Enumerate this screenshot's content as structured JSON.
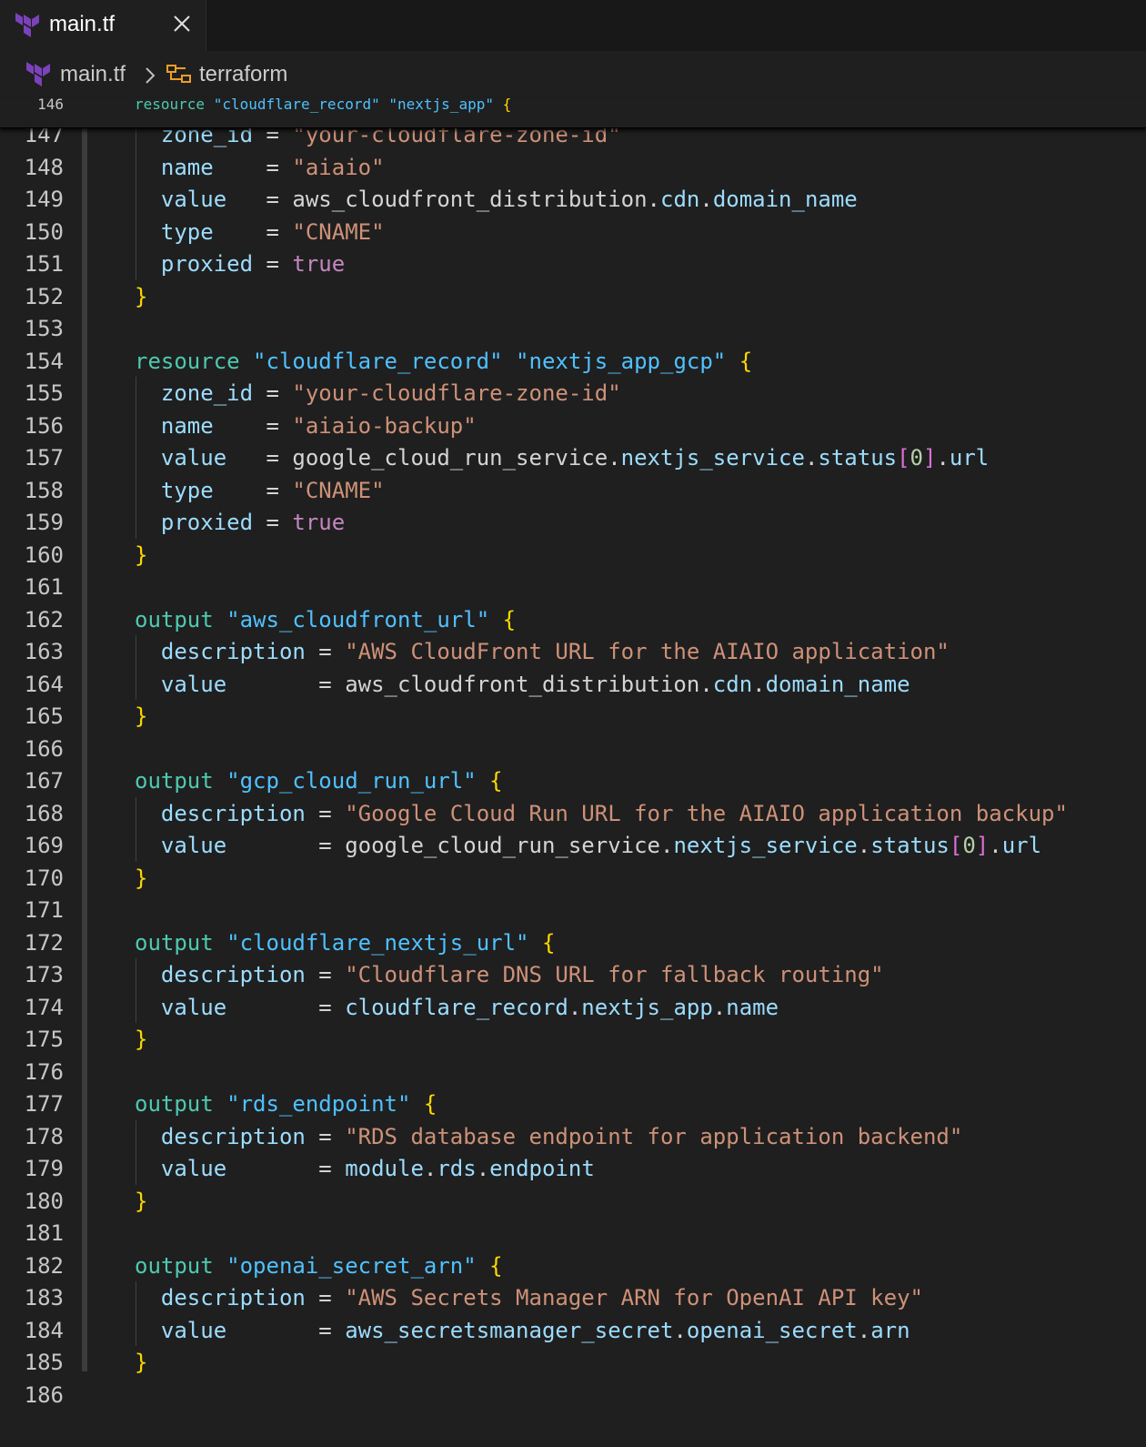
{
  "tab": {
    "label": "main.tf"
  },
  "breadcrumb": {
    "file": "main.tf",
    "symbol": "terraform"
  },
  "colors": {
    "keyword": "#4ec9b0",
    "string": "#ce9178",
    "attribute": "#9cdcfe",
    "bracket": "#ffd700",
    "boolean": "#c586c0"
  },
  "sticky": {
    "number": "146",
    "tokens": [
      {
        "t": "resource",
        "c": "kw"
      },
      {
        "t": " ",
        "c": "txt"
      },
      {
        "t": "\"cloudflare_record\"",
        "c": "lbl"
      },
      {
        "t": " ",
        "c": "txt"
      },
      {
        "t": "\"nextjs_app\"",
        "c": "lbl"
      },
      {
        "t": " ",
        "c": "txt"
      },
      {
        "t": "{",
        "c": "br1"
      }
    ]
  },
  "lines": [
    {
      "n": "147",
      "tokens": [
        {
          "t": "  zone_id",
          "c": "attr"
        },
        {
          "t": " = ",
          "c": "op"
        },
        {
          "t": "\"your-cloudflare-zone-id\"",
          "c": "str"
        }
      ]
    },
    {
      "n": "148",
      "tokens": [
        {
          "t": "  name",
          "c": "attr"
        },
        {
          "t": "    = ",
          "c": "op"
        },
        {
          "t": "\"aiaio\"",
          "c": "str"
        }
      ]
    },
    {
      "n": "149",
      "tokens": [
        {
          "t": "  value",
          "c": "attr"
        },
        {
          "t": "   = ",
          "c": "op"
        },
        {
          "t": "aws_cloudfront_distribution",
          "c": "txt"
        },
        {
          "t": ".",
          "c": "op"
        },
        {
          "t": "cdn",
          "c": "attr"
        },
        {
          "t": ".",
          "c": "op"
        },
        {
          "t": "domain_name",
          "c": "attr"
        }
      ]
    },
    {
      "n": "150",
      "tokens": [
        {
          "t": "  type",
          "c": "attr"
        },
        {
          "t": "    = ",
          "c": "op"
        },
        {
          "t": "\"CNAME\"",
          "c": "str"
        }
      ]
    },
    {
      "n": "151",
      "tokens": [
        {
          "t": "  proxied",
          "c": "attr"
        },
        {
          "t": " = ",
          "c": "op"
        },
        {
          "t": "true",
          "c": "bool"
        }
      ]
    },
    {
      "n": "152",
      "tokens": [
        {
          "t": "}",
          "c": "br1"
        }
      ]
    },
    {
      "n": "153",
      "tokens": []
    },
    {
      "n": "154",
      "tokens": [
        {
          "t": "resource",
          "c": "kw"
        },
        {
          "t": " ",
          "c": "txt"
        },
        {
          "t": "\"cloudflare_record\"",
          "c": "lbl"
        },
        {
          "t": " ",
          "c": "txt"
        },
        {
          "t": "\"nextjs_app_gcp\"",
          "c": "lbl"
        },
        {
          "t": " ",
          "c": "txt"
        },
        {
          "t": "{",
          "c": "br1"
        }
      ]
    },
    {
      "n": "155",
      "tokens": [
        {
          "t": "  zone_id",
          "c": "attr"
        },
        {
          "t": " = ",
          "c": "op"
        },
        {
          "t": "\"your-cloudflare-zone-id\"",
          "c": "str"
        }
      ]
    },
    {
      "n": "156",
      "tokens": [
        {
          "t": "  name",
          "c": "attr"
        },
        {
          "t": "    = ",
          "c": "op"
        },
        {
          "t": "\"aiaio-backup\"",
          "c": "str"
        }
      ]
    },
    {
      "n": "157",
      "tokens": [
        {
          "t": "  value",
          "c": "attr"
        },
        {
          "t": "   = ",
          "c": "op"
        },
        {
          "t": "google_cloud_run_service",
          "c": "txt"
        },
        {
          "t": ".",
          "c": "op"
        },
        {
          "t": "nextjs_service",
          "c": "attr"
        },
        {
          "t": ".",
          "c": "op"
        },
        {
          "t": "status",
          "c": "attr"
        },
        {
          "t": "[",
          "c": "br2"
        },
        {
          "t": "0",
          "c": "num"
        },
        {
          "t": "]",
          "c": "br2"
        },
        {
          "t": ".",
          "c": "op"
        },
        {
          "t": "url",
          "c": "attr"
        }
      ]
    },
    {
      "n": "158",
      "tokens": [
        {
          "t": "  type",
          "c": "attr"
        },
        {
          "t": "    = ",
          "c": "op"
        },
        {
          "t": "\"CNAME\"",
          "c": "str"
        }
      ]
    },
    {
      "n": "159",
      "tokens": [
        {
          "t": "  proxied",
          "c": "attr"
        },
        {
          "t": " = ",
          "c": "op"
        },
        {
          "t": "true",
          "c": "bool"
        }
      ]
    },
    {
      "n": "160",
      "tokens": [
        {
          "t": "}",
          "c": "br1"
        }
      ]
    },
    {
      "n": "161",
      "tokens": []
    },
    {
      "n": "162",
      "tokens": [
        {
          "t": "output",
          "c": "kw"
        },
        {
          "t": " ",
          "c": "txt"
        },
        {
          "t": "\"aws_cloudfront_url\"",
          "c": "lbl"
        },
        {
          "t": " ",
          "c": "txt"
        },
        {
          "t": "{",
          "c": "br1"
        }
      ]
    },
    {
      "n": "163",
      "tokens": [
        {
          "t": "  description",
          "c": "attr"
        },
        {
          "t": " = ",
          "c": "op"
        },
        {
          "t": "\"AWS CloudFront URL for the AIAIO application\"",
          "c": "str"
        }
      ]
    },
    {
      "n": "164",
      "tokens": [
        {
          "t": "  value",
          "c": "attr"
        },
        {
          "t": "       = ",
          "c": "op"
        },
        {
          "t": "aws_cloudfront_distribution",
          "c": "txt"
        },
        {
          "t": ".",
          "c": "op"
        },
        {
          "t": "cdn",
          "c": "attr"
        },
        {
          "t": ".",
          "c": "op"
        },
        {
          "t": "domain_name",
          "c": "attr"
        }
      ]
    },
    {
      "n": "165",
      "tokens": [
        {
          "t": "}",
          "c": "br1"
        }
      ]
    },
    {
      "n": "166",
      "tokens": []
    },
    {
      "n": "167",
      "tokens": [
        {
          "t": "output",
          "c": "kw"
        },
        {
          "t": " ",
          "c": "txt"
        },
        {
          "t": "\"gcp_cloud_run_url\"",
          "c": "lbl"
        },
        {
          "t": " ",
          "c": "txt"
        },
        {
          "t": "{",
          "c": "br1"
        }
      ]
    },
    {
      "n": "168",
      "tokens": [
        {
          "t": "  description",
          "c": "attr"
        },
        {
          "t": " = ",
          "c": "op"
        },
        {
          "t": "\"Google Cloud Run URL for the AIAIO application backup\"",
          "c": "str"
        }
      ]
    },
    {
      "n": "169",
      "tokens": [
        {
          "t": "  value",
          "c": "attr"
        },
        {
          "t": "       = ",
          "c": "op"
        },
        {
          "t": "google_cloud_run_service",
          "c": "txt"
        },
        {
          "t": ".",
          "c": "op"
        },
        {
          "t": "nextjs_service",
          "c": "attr"
        },
        {
          "t": ".",
          "c": "op"
        },
        {
          "t": "status",
          "c": "attr"
        },
        {
          "t": "[",
          "c": "br2"
        },
        {
          "t": "0",
          "c": "num"
        },
        {
          "t": "]",
          "c": "br2"
        },
        {
          "t": ".",
          "c": "op"
        },
        {
          "t": "url",
          "c": "attr"
        }
      ]
    },
    {
      "n": "170",
      "tokens": [
        {
          "t": "}",
          "c": "br1"
        }
      ]
    },
    {
      "n": "171",
      "tokens": []
    },
    {
      "n": "172",
      "tokens": [
        {
          "t": "output",
          "c": "kw"
        },
        {
          "t": " ",
          "c": "txt"
        },
        {
          "t": "\"cloudflare_nextjs_url\"",
          "c": "lbl"
        },
        {
          "t": " ",
          "c": "txt"
        },
        {
          "t": "{",
          "c": "br1"
        }
      ]
    },
    {
      "n": "173",
      "tokens": [
        {
          "t": "  description",
          "c": "attr"
        },
        {
          "t": " = ",
          "c": "op"
        },
        {
          "t": "\"Cloudflare DNS URL for fallback routing\"",
          "c": "str"
        }
      ]
    },
    {
      "n": "174",
      "tokens": [
        {
          "t": "  value",
          "c": "attr"
        },
        {
          "t": "       = ",
          "c": "op"
        },
        {
          "t": "cloudflare_record",
          "c": "attr"
        },
        {
          "t": ".",
          "c": "op"
        },
        {
          "t": "nextjs_app",
          "c": "attr"
        },
        {
          "t": ".",
          "c": "op"
        },
        {
          "t": "name",
          "c": "attr"
        }
      ]
    },
    {
      "n": "175",
      "tokens": [
        {
          "t": "}",
          "c": "br1"
        }
      ]
    },
    {
      "n": "176",
      "tokens": []
    },
    {
      "n": "177",
      "tokens": [
        {
          "t": "output",
          "c": "kw"
        },
        {
          "t": " ",
          "c": "txt"
        },
        {
          "t": "\"rds_endpoint\"",
          "c": "lbl"
        },
        {
          "t": " ",
          "c": "txt"
        },
        {
          "t": "{",
          "c": "br1"
        }
      ]
    },
    {
      "n": "178",
      "tokens": [
        {
          "t": "  description",
          "c": "attr"
        },
        {
          "t": " = ",
          "c": "op"
        },
        {
          "t": "\"RDS database endpoint for application backend\"",
          "c": "str"
        }
      ]
    },
    {
      "n": "179",
      "tokens": [
        {
          "t": "  value",
          "c": "attr"
        },
        {
          "t": "       = ",
          "c": "op"
        },
        {
          "t": "module",
          "c": "attr"
        },
        {
          "t": ".",
          "c": "op"
        },
        {
          "t": "rds",
          "c": "attr"
        },
        {
          "t": ".",
          "c": "op"
        },
        {
          "t": "endpoint",
          "c": "attr"
        }
      ]
    },
    {
      "n": "180",
      "tokens": [
        {
          "t": "}",
          "c": "br1"
        }
      ]
    },
    {
      "n": "181",
      "tokens": []
    },
    {
      "n": "182",
      "tokens": [
        {
          "t": "output",
          "c": "kw"
        },
        {
          "t": " ",
          "c": "txt"
        },
        {
          "t": "\"openai_secret_arn\"",
          "c": "lbl"
        },
        {
          "t": " ",
          "c": "txt"
        },
        {
          "t": "{",
          "c": "br1"
        }
      ]
    },
    {
      "n": "183",
      "tokens": [
        {
          "t": "  description",
          "c": "attr"
        },
        {
          "t": " = ",
          "c": "op"
        },
        {
          "t": "\"AWS Secrets Manager ARN for OpenAI API key\"",
          "c": "str"
        }
      ]
    },
    {
      "n": "184",
      "tokens": [
        {
          "t": "  value",
          "c": "attr"
        },
        {
          "t": "       = ",
          "c": "op"
        },
        {
          "t": "aws_secretsmanager_secret",
          "c": "attr"
        },
        {
          "t": ".",
          "c": "op"
        },
        {
          "t": "openai_secret",
          "c": "attr"
        },
        {
          "t": ".",
          "c": "op"
        },
        {
          "t": "arn",
          "c": "attr"
        }
      ]
    },
    {
      "n": "185",
      "tokens": [
        {
          "t": "}",
          "c": "br1"
        }
      ]
    },
    {
      "n": "186",
      "tokens": []
    }
  ]
}
